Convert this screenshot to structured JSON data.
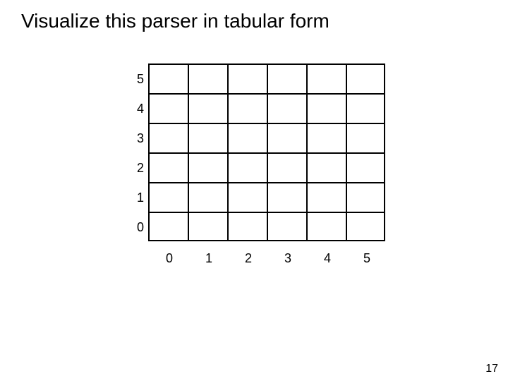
{
  "title": "Visualize this parser in tabular form",
  "page_number": "17",
  "chart_data": {
    "type": "table",
    "title": "Visualize this parser in tabular form",
    "xlabel": "",
    "ylabel": "",
    "x_ticks": [
      "0",
      "1",
      "2",
      "3",
      "4",
      "5"
    ],
    "y_ticks": [
      "0",
      "1",
      "2",
      "3",
      "4",
      "5"
    ],
    "xlim": [
      0,
      5
    ],
    "ylim": [
      0,
      5
    ],
    "cells": [],
    "grid": true
  }
}
